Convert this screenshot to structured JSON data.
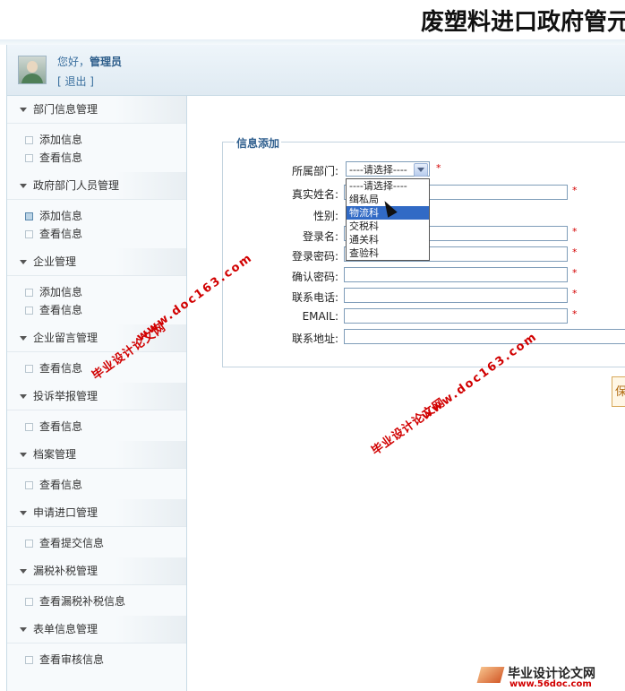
{
  "header": {
    "title": "废塑料进口政府管元"
  },
  "user": {
    "greeting": "您好，",
    "name": "管理员",
    "logout": "[ 退出 ]"
  },
  "sidebar": {
    "groups": [
      {
        "label": "部门信息管理",
        "items": [
          "添加信息",
          "查看信息"
        ]
      },
      {
        "label": "政府部门人员管理",
        "items": [
          "添加信息",
          "查看信息"
        ]
      },
      {
        "label": "企业管理",
        "items": [
          "添加信息",
          "查看信息"
        ]
      },
      {
        "label": "企业留言管理",
        "items": [
          "查看信息"
        ]
      },
      {
        "label": "投诉举报管理",
        "items": [
          "查看信息"
        ]
      },
      {
        "label": "档案管理",
        "items": [
          "查看信息"
        ]
      },
      {
        "label": "申请进口管理",
        "items": [
          "查看提交信息"
        ]
      },
      {
        "label": "漏税补税管理",
        "items": [
          "查看漏税补税信息"
        ]
      },
      {
        "label": "表单信息管理",
        "items": [
          "查看审核信息"
        ]
      }
    ]
  },
  "form": {
    "legend": "信息添加",
    "dept_label": "所属部门:",
    "dept_selected": "----请选择----",
    "dept_options": [
      "----请选择----",
      "缉私局",
      "物流科",
      "交税科",
      "通关科",
      "查验科"
    ],
    "highlighted_option": "物流科",
    "name_label": "真实姓名:",
    "gender_label": "性别:",
    "login_label": "登录名:",
    "password_label": "登录密码:",
    "confirm_label": "确认密码:",
    "phone_label": "联系电话:",
    "email_label": "EMAIL:",
    "address_label": "联系地址:",
    "required_mark": "*",
    "save_label": "保"
  },
  "watermarks": {
    "site": "www.doc163.com",
    "brand": "毕业设计论文网",
    "footer_brand": "毕业设计论文网",
    "footer_site": "www.56doc.com"
  }
}
